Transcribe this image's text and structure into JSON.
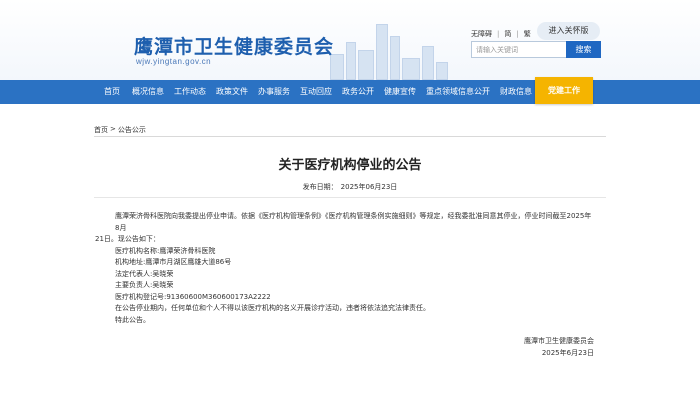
{
  "header": {
    "org_title": "鹰潭市卫生健康委员会",
    "org_url": "wjw.yingtan.gov.cn",
    "top_links": [
      "无障碍",
      "简",
      "繁"
    ],
    "old_version_label": "进入关怀版",
    "search": {
      "placeholder": "请输入关键词",
      "button_label": "搜索"
    }
  },
  "nav": {
    "items": [
      "首页",
      "概况信息",
      "工作动态",
      "政策文件",
      "办事服务",
      "互动回应",
      "政务公开",
      "健康宣传",
      "重点领域信息公开",
      "财政信息"
    ],
    "party_label": "党建工作"
  },
  "breadcrumb": [
    "首页",
    "公告公示"
  ],
  "article": {
    "title": "关于医疗机构停业的公告",
    "date_label": "发布日期：",
    "date": "2025年06月23日",
    "paragraph1_line1": "鹰潭荣济骨科医院向我委提出停业申请。依据《医疗机构管理条例》《医疗机构管理条例实施细则》等规定，经我委批准同意其停业，停业时间截至2025年8月",
    "paragraph1_line2": "21日。现公告如下：",
    "lines": [
      "医疗机构名称:鹰潭荣济骨科医院",
      "机构地址:鹰潭市月湖区鹰雄大道86号",
      "法定代表人:吴晓荣",
      "主要负责人:吴晓荣",
      "医疗机构登记号:91360600M360600173A2222",
      "在公告停业期内，任何单位和个人不得以该医疗机构的名义开展诊疗活动，违者将依法追究法律责任。",
      "特此公告。"
    ],
    "signature_org": "鹰潭市卫生健康委员会",
    "signature_date": "2025年6月23日"
  },
  "colors": {
    "nav_bg": "#2b72c3",
    "party_btn": "#f5b400",
    "title_blue": "#1e5fae"
  }
}
